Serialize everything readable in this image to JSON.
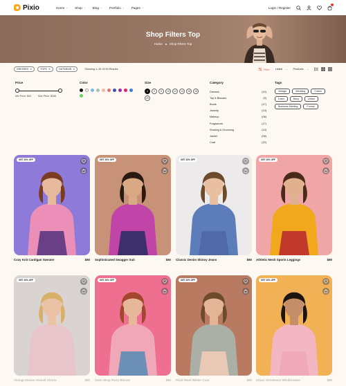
{
  "header": {
    "logo": "Pixio",
    "nav": [
      {
        "label": "Home"
      },
      {
        "label": "Shop"
      },
      {
        "label": "Blog"
      },
      {
        "label": "Portfolio"
      },
      {
        "label": "Pages"
      }
    ],
    "login": "Login / Register",
    "icons": [
      "search-icon",
      "user-icon",
      "heart-icon",
      "cart-icon"
    ]
  },
  "hero": {
    "title": "Shop Filters Top",
    "breadcrumb": [
      "Home",
      "Shop Filters Top"
    ]
  },
  "filterbar": {
    "chips": [
      "DRESSES",
      "TOPS",
      "OUTWEAR"
    ],
    "results": "Showing 1–15 Of 50 Results",
    "filter_label": "Filter",
    "sort_label": "Listed",
    "perpage_label": "Products"
  },
  "price": {
    "title": "Price",
    "min_label": "Min Price: $40",
    "max_label": "Max Price: $346",
    "range": [
      0.0,
      0.97
    ]
  },
  "color": {
    "title": "Color",
    "swatches": [
      "#111111",
      "#ffffff",
      "#7ab8e4",
      "#9ec3ad",
      "#f2b8a2",
      "#e57373",
      "#3f51b5",
      "#9c27b0",
      "#e91e63",
      "#3e7be0",
      "#5cd75c"
    ]
  },
  "size": {
    "title": "Size",
    "options": [
      "4",
      "6",
      "8",
      "10",
      "12",
      "14",
      "16",
      "18",
      "20"
    ],
    "active": "4"
  },
  "category": {
    "title": "Category",
    "items": [
      {
        "name": "Dresses",
        "count": "(10)"
      },
      {
        "name": "Top & Blouses",
        "count": "(5)"
      },
      {
        "name": "Boots",
        "count": "(17)"
      },
      {
        "name": "Jewelry",
        "count": "(13)"
      },
      {
        "name": "Makeup",
        "count": "(06)"
      },
      {
        "name": "Fragrances",
        "count": "(17)"
      },
      {
        "name": "Shaving & Grooming",
        "count": "(13)"
      },
      {
        "name": "Jacket",
        "count": "(06)"
      },
      {
        "name": "Coat",
        "count": "(22)"
      }
    ]
  },
  "tags": {
    "title": "Tags",
    "items": [
      "Vintage",
      "Wedding",
      "Cotton",
      "Linen",
      "Navy",
      "Urban",
      "Business Meeting",
      "Formal"
    ]
  },
  "products": [
    {
      "badge": "GET 20% OFF",
      "name": "Cozy Knit Cardigan Sweater",
      "price": "$80",
      "bg": "#8e7ad8",
      "top": "#ec8fb8",
      "bottom": "#6a3f86",
      "skin": "#e6b99c",
      "hair": "#7a3b22"
    },
    {
      "badge": "GET 20% OFF",
      "name": "Sophisticated Swagger Suit",
      "price": "$80",
      "bg": "#c79277",
      "top": "#c145a9",
      "bottom": "#3d2f6c",
      "skin": "#d9a986",
      "hair": "#2a1a12"
    },
    {
      "badge": "GET 20% OFF",
      "name": "Classic Denim Skinny Jeans",
      "price": "$80",
      "bg": "#eceaea",
      "top": "#5d7dba",
      "bottom": "#4f6aa6",
      "skin": "#e9bfa2",
      "hair": "#6b4a2e"
    },
    {
      "badge": "GET 20% OFF",
      "name": "Athletic Mesh Sports Leggings",
      "price": "$80",
      "bg": "#f0a6a7",
      "top": "#f2a81d",
      "bottom": "#c0392b",
      "skin": "#e1b08e",
      "hair": "#4a2a18"
    },
    {
      "badge": "GET 20% OFF",
      "name": "Vintage Denim Overall Shorts",
      "price": "$80",
      "bg": "#d9d4d2",
      "top": "#e8c4cb",
      "bottom": "#e8c4cb",
      "skin": "#eac3a6",
      "hair": "#d9b068"
    },
    {
      "badge": "GET 20% OFF",
      "name": "Satin Wrap Party Blouse",
      "price": "$80",
      "bg": "#ee6f8f",
      "top": "#f0a7b8",
      "bottom": "#6b8fb5",
      "skin": "#e7b79a",
      "hair": "#a3462e"
    },
    {
      "badge": "GET 20% OFF",
      "name": "Plaid Wool Winter Coat",
      "price": "$80",
      "bg": "#b97a62",
      "top": "#aab0a6",
      "bottom": "#e9c9b6",
      "skin": "#e3b495",
      "hair": "#6e4a2d"
    },
    {
      "badge": "GET 20% OFF",
      "name": "Urban Streetwear Windbreaker",
      "price": "$80",
      "bg": "#f2b155",
      "top": "#f3b7c3",
      "bottom": "#f0a9b8",
      "skin": "#c48e68",
      "hair": "#1e1410"
    }
  ]
}
